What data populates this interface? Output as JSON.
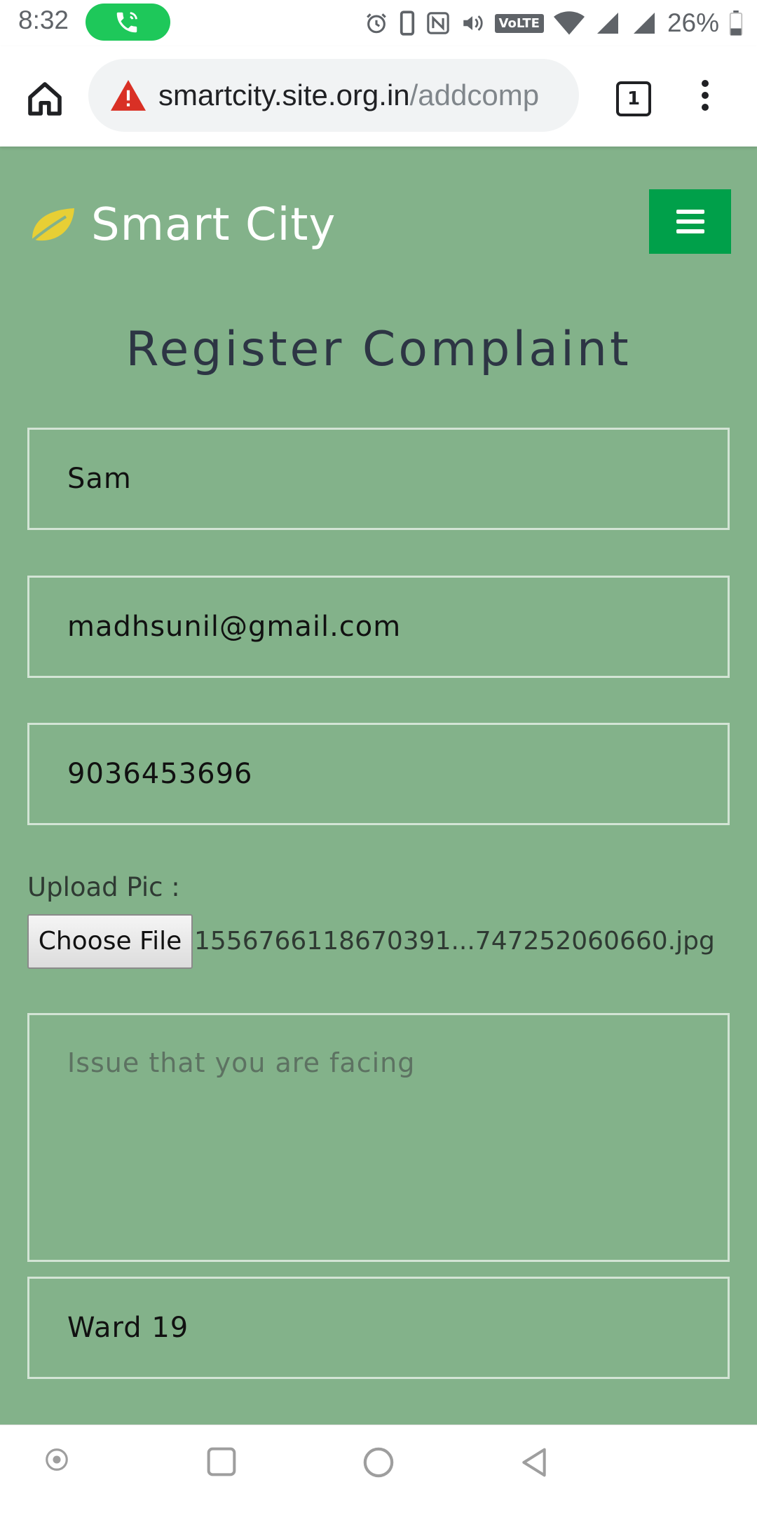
{
  "status_bar": {
    "time": "8:32",
    "volte": "VoLTE",
    "battery": "26%"
  },
  "browser": {
    "url_host": "smartcity.site.org.in",
    "url_path": "/addcomp",
    "tab_count": "1"
  },
  "site": {
    "brand": "Smart City",
    "title": "Register Complaint"
  },
  "form": {
    "name_value": "Sam",
    "email_value": "madhsunil@gmail.com",
    "phone_value": "9036453696",
    "upload_label": "Upload Pic :",
    "choose_file_label": "Choose File",
    "file_name": "1556766118670391...747252060660.jpg",
    "issue_placeholder": "Issue that you are facing",
    "ward_value": "Ward 19"
  },
  "colors": {
    "page_bg": "#83b28a",
    "menu_button": "#00a04a",
    "title_text": "#2d3544"
  }
}
